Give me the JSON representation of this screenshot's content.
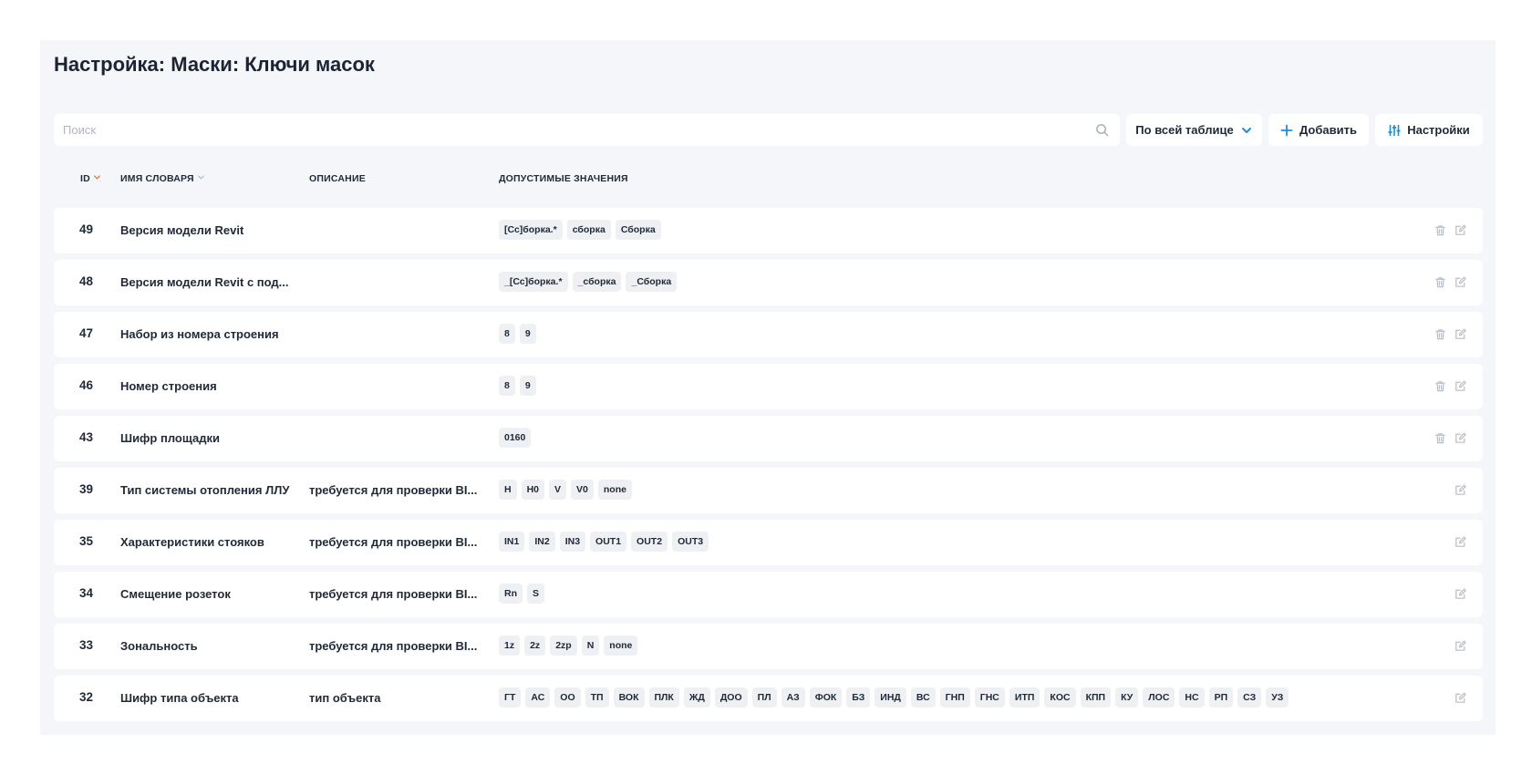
{
  "page": {
    "title": "Настройка: Маски: Ключи масок"
  },
  "toolbar": {
    "search_placeholder": "Поиск",
    "search_value": "",
    "scope_label": "По всей таблице",
    "add_label": "Добавить",
    "settings_label": "Настройки"
  },
  "table": {
    "columns": {
      "id": "ID",
      "name": "ИМЯ СЛОВАРЯ",
      "description": "ОПИСАНИЕ",
      "values": "ДОПУСТИМЫЕ ЗНАЧЕНИЯ"
    },
    "rows": [
      {
        "id": "49",
        "name": "Версия модели Revit",
        "description": "",
        "values": [
          "[Сс]борка.*",
          "сборка",
          "Сборка"
        ],
        "deletable": true
      },
      {
        "id": "48",
        "name": "Версия модели Revit с под...",
        "description": "",
        "values": [
          "_[Сс]борка.*",
          "_сборка",
          "_Сборка"
        ],
        "deletable": true
      },
      {
        "id": "47",
        "name": "Набор из номера строения",
        "description": "",
        "values": [
          "8",
          "9"
        ],
        "deletable": true
      },
      {
        "id": "46",
        "name": "Номер строения",
        "description": "",
        "values": [
          "8",
          "9"
        ],
        "deletable": true
      },
      {
        "id": "43",
        "name": "Шифр площадки",
        "description": "",
        "values": [
          "0160"
        ],
        "deletable": true
      },
      {
        "id": "39",
        "name": "Тип системы отопления ЛЛУ",
        "description": "требуется для проверки BI...",
        "values": [
          "H",
          "H0",
          "V",
          "V0",
          "none"
        ],
        "deletable": false
      },
      {
        "id": "35",
        "name": "Характеристики стояков",
        "description": "требуется для проверки BI...",
        "values": [
          "IN1",
          "IN2",
          "IN3",
          "OUT1",
          "OUT2",
          "OUT3"
        ],
        "deletable": false
      },
      {
        "id": "34",
        "name": "Смещение розеток",
        "description": "требуется для проверки BI...",
        "values": [
          "Rn",
          "S"
        ],
        "deletable": false
      },
      {
        "id": "33",
        "name": "Зональность",
        "description": "требуется для проверки BI...",
        "values": [
          "1z",
          "2z",
          "2zp",
          "N",
          "none"
        ],
        "deletable": false
      },
      {
        "id": "32",
        "name": "Шифр типа объекта",
        "description": "тип объекта",
        "values": [
          "ГТ",
          "АС",
          "ОО",
          "ТП",
          "ВОК",
          "ПЛК",
          "ЖД",
          "ДОО",
          "ПЛ",
          "АЗ",
          "ФОК",
          "БЗ",
          "ИНД",
          "ВС",
          "ГНП",
          "ГНС",
          "ИТП",
          "КОС",
          "КПП",
          "КУ",
          "ЛОС",
          "НС",
          "РП",
          "СЗ",
          "УЗ"
        ],
        "deletable": false
      }
    ]
  },
  "icons": {
    "search": "search-icon",
    "chevron": "chevron-down-icon",
    "add": "plus-icon",
    "settings": "sliders-icon",
    "delete": "trash-icon",
    "edit": "edit-icon"
  },
  "colors": {
    "accent": "#1a8fe0",
    "sort_active": "#f07b3f",
    "panel_bg": "#f4f6fa",
    "tag_bg": "#eef0f4",
    "muted_icon": "#b8bdc6"
  }
}
